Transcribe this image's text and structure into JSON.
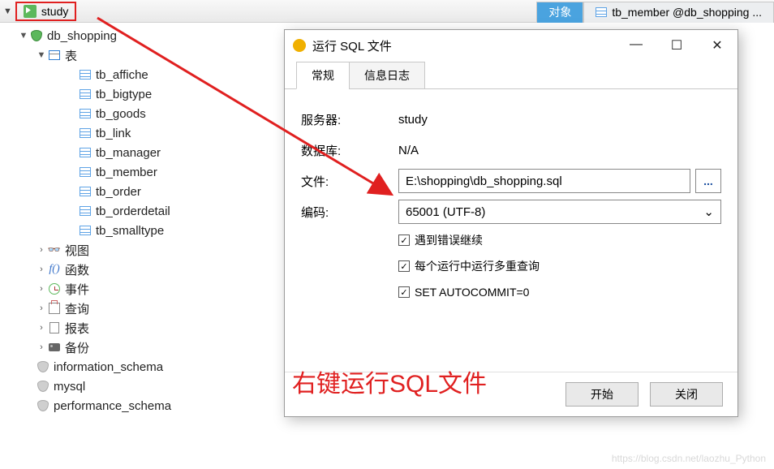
{
  "header": {
    "connection": "study",
    "tabs": [
      {
        "label": "对象",
        "active": true
      },
      {
        "label": "tb_member @db_shopping ...",
        "active": false
      }
    ]
  },
  "tree": {
    "database": "db_shopping",
    "tables_group": "表",
    "tables": [
      "tb_affiche",
      "tb_bigtype",
      "tb_goods",
      "tb_link",
      "tb_manager",
      "tb_member",
      "tb_order",
      "tb_orderdetail",
      "tb_smalltype"
    ],
    "groups": {
      "views": "视图",
      "functions": "函数",
      "events": "事件",
      "queries": "查询",
      "reports": "报表",
      "backup": "备份"
    },
    "other_dbs": [
      "information_schema",
      "mysql",
      "performance_schema"
    ]
  },
  "dialog": {
    "title": "运行 SQL 文件",
    "tabs": {
      "general": "常规",
      "log": "信息日志"
    },
    "labels": {
      "server": "服务器:",
      "database": "数据库:",
      "file": "文件:",
      "encoding": "编码:"
    },
    "values": {
      "server": "study",
      "database": "N/A",
      "file": "E:\\shopping\\db_shopping.sql",
      "encoding": "65001 (UTF-8)"
    },
    "browse_btn": "...",
    "checkboxes": {
      "continue_on_error": "遇到错误继续",
      "multi_query": "每个运行中运行多重查询",
      "autocommit": "SET AUTOCOMMIT=0"
    },
    "buttons": {
      "start": "开始",
      "close": "关闭"
    }
  },
  "annotation": "右键运行SQL文件",
  "watermark": "https://blog.csdn.net/laozhu_Python"
}
